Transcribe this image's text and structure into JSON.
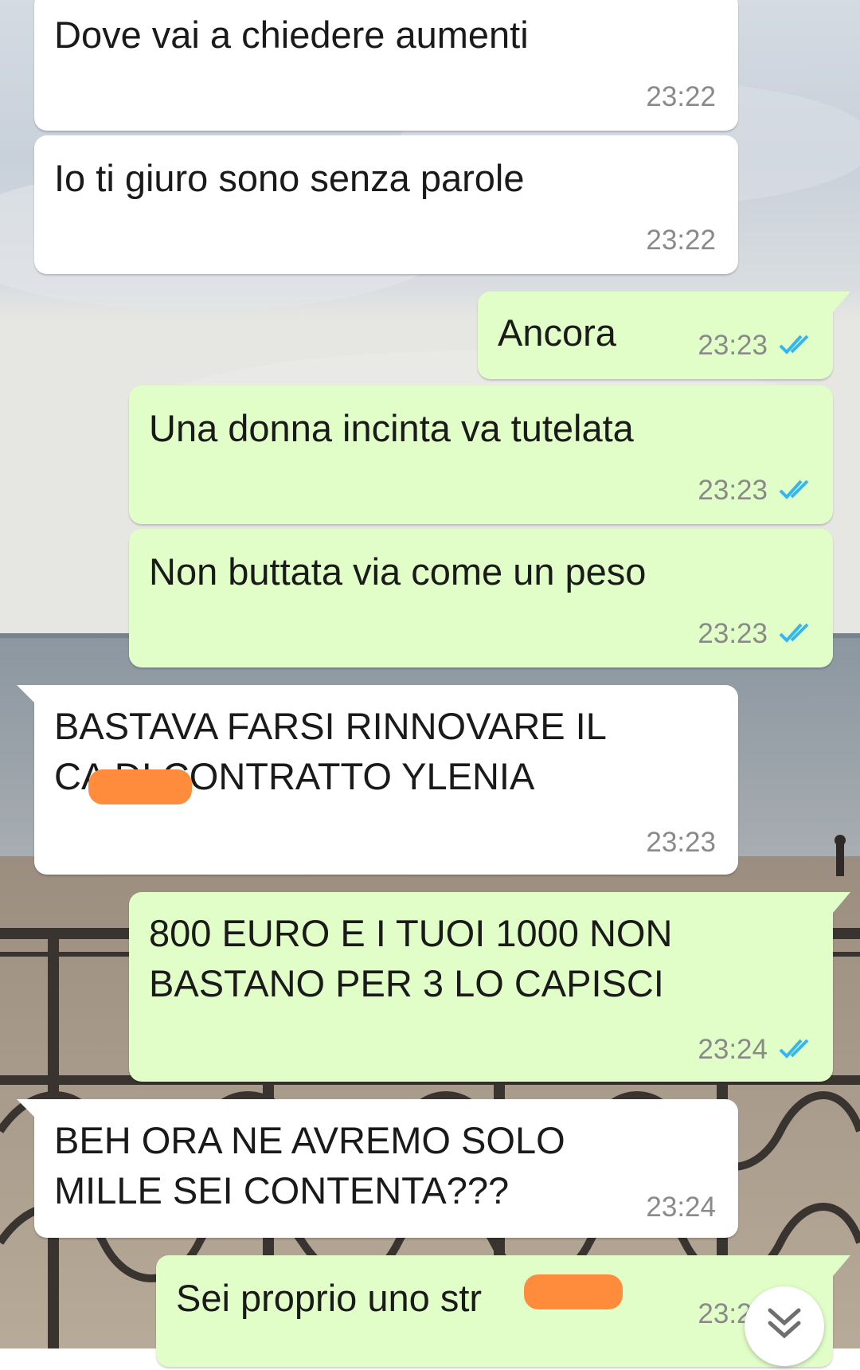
{
  "colors": {
    "incoming_bubble": "#ffffff",
    "outgoing_bubble": "#e2fec8",
    "read_ticks": "#34b7f1",
    "redaction": "#ff8b3d"
  },
  "messages": [
    {
      "direction": "in",
      "text": "Dove vai a chiedere aumenti",
      "time": "23:22"
    },
    {
      "direction": "in",
      "text": "Io ti giuro sono senza parole",
      "time": "23:22"
    },
    {
      "direction": "out",
      "text": "Ancora",
      "time": "23:23",
      "status": "read"
    },
    {
      "direction": "out",
      "text": "Una donna incinta va tutelata",
      "time": "23:23",
      "status": "read"
    },
    {
      "direction": "out",
      "text": "Non buttata via come un peso",
      "time": "23:23",
      "status": "read"
    },
    {
      "direction": "in",
      "text": "BASTAVA FARSI RINNOVARE IL\nCA       DI CONTRATTO YLENIA",
      "time": "23:23"
    },
    {
      "direction": "out",
      "text": "800 EURO E I TUOI 1000 NON\nBASTANO PER 3 LO CAPISCI",
      "time": "23:24",
      "status": "read"
    },
    {
      "direction": "in",
      "text": "BEH ORA NE AVREMO SOLO\nMILLE SEI CONTENTA???",
      "time": "23:24"
    },
    {
      "direction": "out",
      "text": "Sei proprio uno str",
      "time": "23:24",
      "status": "read"
    }
  ],
  "scroll_button": {
    "icon": "double-chevron-down-icon"
  }
}
